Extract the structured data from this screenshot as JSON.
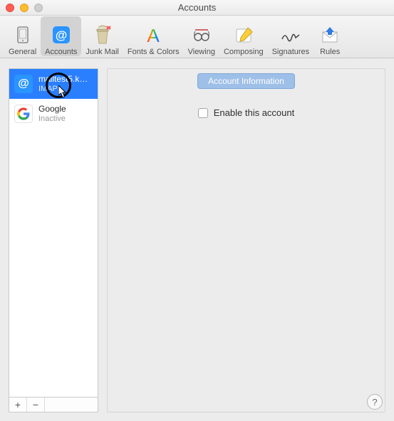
{
  "window": {
    "title": "Accounts"
  },
  "toolbar": {
    "items": [
      {
        "id": "general",
        "label": "General"
      },
      {
        "id": "accounts",
        "label": "Accounts"
      },
      {
        "id": "junk",
        "label": "Junk Mail"
      },
      {
        "id": "fonts",
        "label": "Fonts & Colors"
      },
      {
        "id": "viewing",
        "label": "Viewing"
      },
      {
        "id": "composing",
        "label": "Composing"
      },
      {
        "id": "signatures",
        "label": "Signatures"
      },
      {
        "id": "rules",
        "label": "Rules"
      }
    ]
  },
  "sidebar": {
    "accounts": [
      {
        "name": "mailtest5.k…",
        "subtitle": "IMAP",
        "icon": "at",
        "selected": true
      },
      {
        "name": "Google",
        "subtitle": "Inactive",
        "icon": "google",
        "selected": false
      }
    ],
    "add_label": "+",
    "remove_label": "−"
  },
  "main": {
    "tab_label": "Account Information",
    "enable_label": "Enable this account",
    "enable_checked": false
  },
  "help_label": "?"
}
